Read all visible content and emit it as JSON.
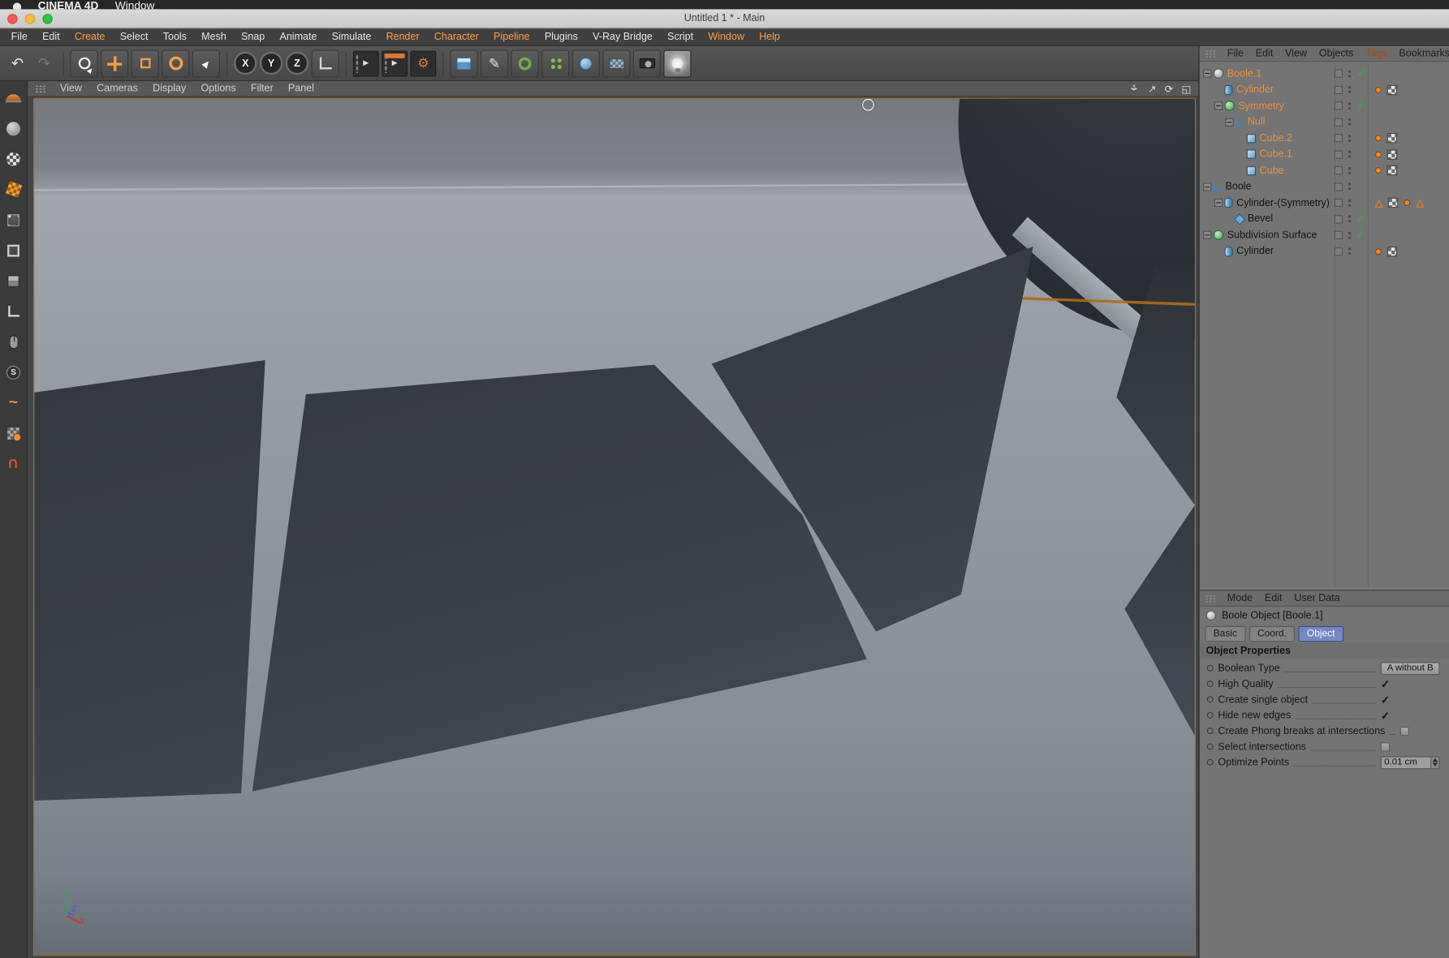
{
  "colors": {
    "accent_orange": "#ff9d40",
    "selection_orange": "#ef8f35",
    "tab_active_blue": "#7488c2",
    "check_green": "#2fae3f",
    "viewport_border": "#b06a20"
  },
  "icons": {
    "undo": "↶",
    "redo": "↷",
    "cursor": "►",
    "gear": "⚙",
    "pen": "✎",
    "rotate_view": "⟳",
    "maximize": "◱",
    "pan_h": "↔",
    "pan_v": "↕",
    "dolly": "↗",
    "check": "✓",
    "warning": "△",
    "s_mode": "S",
    "swirl": "~",
    "magnet": "U",
    "render": "►"
  },
  "macos_bar": {
    "app_name": "CINEMA 4D",
    "items": [
      "Window"
    ]
  },
  "titlebar": {
    "title": "Untitled 1 * - Main"
  },
  "menubar": {
    "items": [
      {
        "label": "File",
        "accent": false
      },
      {
        "label": "Edit",
        "accent": false
      },
      {
        "label": "Create",
        "accent": true
      },
      {
        "label": "Select",
        "accent": false
      },
      {
        "label": "Tools",
        "accent": false
      },
      {
        "label": "Mesh",
        "accent": false
      },
      {
        "label": "Snap",
        "accent": false
      },
      {
        "label": "Animate",
        "accent": false
      },
      {
        "label": "Simulate",
        "accent": false
      },
      {
        "label": "Render",
        "accent": true
      },
      {
        "label": "Character",
        "accent": true
      },
      {
        "label": "Pipeline",
        "accent": true
      },
      {
        "label": "Plugins",
        "accent": false
      },
      {
        "label": "V-Ray Bridge",
        "accent": false
      },
      {
        "label": "Script",
        "accent": false
      },
      {
        "label": "Window",
        "accent": true
      },
      {
        "label": "Help",
        "accent": true
      }
    ]
  },
  "toolbar": {
    "axis_letters": [
      "X",
      "Y",
      "Z"
    ],
    "icon_names": [
      "undo",
      "redo",
      "live-selection",
      "move-tool",
      "scale-tool",
      "rotate-tool",
      "last-used-tool",
      "x-axis-lock",
      "y-axis-lock",
      "z-axis-lock",
      "coordinate-system",
      "render-view",
      "render-settings",
      "interactive-render",
      "add-cube-primitive",
      "spline-pen",
      "modeling-torus",
      "array-clone",
      "deformer-sphere",
      "floor-environment",
      "camera",
      "light"
    ]
  },
  "left_palette": {
    "icon_names": [
      "make-editable",
      "model-mode",
      "texture-mode",
      "texture-axis-mode",
      "points-mode",
      "edges-mode",
      "polygons-mode",
      "object-axis-mode",
      "viewport-solo",
      "simulation-mode",
      "tweak-mode",
      "lock-workplane",
      "snap-magnet"
    ]
  },
  "viewport": {
    "menu": [
      "View",
      "Cameras",
      "Display",
      "Options",
      "Filter",
      "Panel"
    ],
    "view_control_names": [
      "pan-view",
      "dolly-view",
      "rotate-view",
      "toggle-view"
    ],
    "axis_gizmo": {
      "x": "X",
      "y": "Y",
      "z": "Z"
    }
  },
  "object_manager": {
    "menu": [
      {
        "label": "File",
        "accent": false
      },
      {
        "label": "Edit",
        "accent": false
      },
      {
        "label": "View",
        "accent": false
      },
      {
        "label": "Objects",
        "accent": false
      },
      {
        "label": "Tags",
        "accent": true
      },
      {
        "label": "Bookmarks",
        "accent": false
      }
    ],
    "rows": [
      {
        "label": "Boole.1",
        "depth": 0,
        "selected": true,
        "icon": "boole",
        "expander": true,
        "state": "check",
        "tags": []
      },
      {
        "label": "Cylinder",
        "depth": 1,
        "selected": true,
        "icon": "cylinder",
        "expander": false,
        "state": "",
        "tags": [
          "dot",
          "texture"
        ]
      },
      {
        "label": "Symmetry",
        "depth": 1,
        "selected": true,
        "icon": "symmetry",
        "expander": true,
        "state": "check",
        "tags": []
      },
      {
        "label": "Null",
        "depth": 2,
        "selected": true,
        "icon": "null",
        "expander": true,
        "state": "",
        "tags": []
      },
      {
        "label": "Cube.2",
        "depth": 3,
        "selected": true,
        "icon": "cube",
        "expander": false,
        "state": "",
        "tags": [
          "dot",
          "texture"
        ]
      },
      {
        "label": "Cube.1",
        "depth": 3,
        "selected": true,
        "icon": "cube",
        "expander": false,
        "state": "",
        "tags": [
          "dot",
          "texture"
        ]
      },
      {
        "label": "Cube",
        "depth": 3,
        "selected": true,
        "icon": "cube",
        "expander": false,
        "state": "",
        "tags": [
          "dot",
          "texture"
        ]
      },
      {
        "label": "Boole",
        "depth": 0,
        "selected": false,
        "icon": "null",
        "expander": true,
        "state": "",
        "tags": []
      },
      {
        "label": "Cylinder-(Symmetry)",
        "depth": 1,
        "selected": false,
        "icon": "cylinder",
        "expander": true,
        "state": "",
        "tags": [
          "warning",
          "texture",
          "dot",
          "warning"
        ]
      },
      {
        "label": "Bevel",
        "depth": 2,
        "selected": false,
        "icon": "bevel",
        "expander": false,
        "state": "check",
        "tags": []
      },
      {
        "label": "Subdivision Surface",
        "depth": 0,
        "selected": false,
        "icon": "sds",
        "expander": true,
        "state": "check",
        "tags": []
      },
      {
        "label": "Cylinder",
        "depth": 1,
        "selected": false,
        "icon": "cylinder",
        "expander": false,
        "state": "",
        "tags": [
          "dot",
          "texture"
        ]
      }
    ]
  },
  "attributes": {
    "menu": [
      "Mode",
      "Edit",
      "User Data"
    ],
    "object_title": "Boole Object [Boole.1]",
    "tabs": [
      {
        "label": "Basic",
        "active": false
      },
      {
        "label": "Coord.",
        "active": false
      },
      {
        "label": "Object",
        "active": true
      }
    ],
    "section_title": "Object Properties",
    "rows": [
      {
        "label": "Boolean Type",
        "control": "dropdown",
        "value": "A without B"
      },
      {
        "label": "High Quality",
        "control": "check",
        "checked": true
      },
      {
        "label": "Create single object",
        "control": "check",
        "checked": true
      },
      {
        "label": "Hide new edges",
        "control": "check",
        "checked": true
      },
      {
        "label": "Create Phong breaks at intersections",
        "control": "checkbox",
        "checked": false
      },
      {
        "label": "Select intersections",
        "control": "checkbox",
        "checked": false
      },
      {
        "label": "Optimize Points",
        "control": "stepper",
        "value": "0.01 cm"
      }
    ]
  }
}
